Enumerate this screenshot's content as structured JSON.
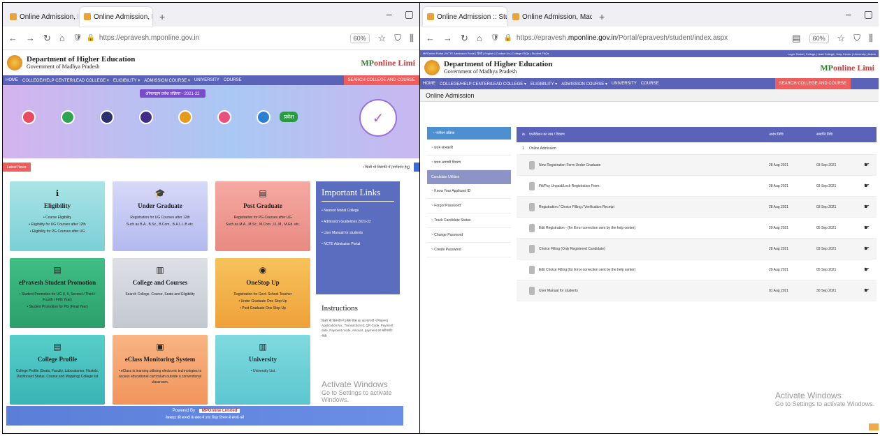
{
  "left": {
    "tabs": [
      {
        "title": "Online Admission, Madhya Pra",
        "active": false
      },
      {
        "title": "Online Admission, Madhya Pra",
        "active": true
      }
    ],
    "url": "https://epravesh.mponline.gov.in",
    "zoom": "60%",
    "site": {
      "dept": "Department of Higher Education",
      "gov": "Government of Madhya Pradesh",
      "brand_a": "MP",
      "brand_b": "online Limi",
      "menu": [
        "HOME",
        "COLLEGE/HELP CENTER/LEAD COLLEGE ▾",
        "ELIGIBILITY ▾",
        "ADMISSION COURSE ▾",
        "UNIVERSITY",
        "COURSE"
      ],
      "search": "SEARCH COLLEGE AND COURSE"
    },
    "hero": {
      "badge": "ऑनलाइन प्रवेश प्रक्रिया - 2021-22",
      "prav": "प्रवेश"
    },
    "ticker": {
      "label": "Latest News",
      "text": "• किसी भी विसंगति में (मार्गदर्शन हेतु)"
    },
    "cards": [
      {
        "title": "Eligibility",
        "desc1": "• Course Eligibility",
        "desc2": "• Eligibility for UG Courses after 12th",
        "desc3": "• Eligibility for PG Courses after UG"
      },
      {
        "title": "Under Graduate",
        "desc1": "Registration for UG Courses after 12th",
        "desc2": "Such as B.A., B.Sc., B.Com., B.A.L.L.B etc.",
        "desc3": ""
      },
      {
        "title": "Post Graduate",
        "desc1": "Registration for PG Courses after UG",
        "desc2": "Such as M.A., M.Sc., M.Com., LL.M., M.Ed. etc.",
        "desc3": ""
      },
      {
        "title": "ePravesh Student Promotion",
        "desc1": "• Student Promotion for UG (I, II, Second / Third / Fourth / Fifth Year)",
        "desc2": "• Student Promotion for PG (Final Year)",
        "desc3": ""
      },
      {
        "title": "College and Courses",
        "desc1": "Search College, Course, Seats and Eligibility",
        "desc2": "",
        "desc3": ""
      },
      {
        "title": "OneStop Up",
        "desc1": "Registration for Govt. School Teacher",
        "desc2": "• Under Graduate One Stop Up",
        "desc3": "• Post Graduate One Stop Up"
      },
      {
        "title": "College Profile",
        "desc1": "College Profile (Seats, Faculty, Laboratories, Hostels, Dashboard Status, Course and Mapping) College list",
        "desc2": "",
        "desc3": ""
      },
      {
        "title": "eClass Monitoring System",
        "desc1": "• eClass is learning utilising electronic technologies to access educational curriculum outside a conventional classroom.",
        "desc2": "",
        "desc3": ""
      },
      {
        "title": "University",
        "desc1": "• University List",
        "desc2": "",
        "desc3": ""
      }
    ],
    "links": {
      "title": "Important Links",
      "items": [
        "• Nearest Nodal College",
        "• Admission Guidelines 2021-22",
        "• User Manual for students",
        "• NCTE Admission Portal"
      ]
    },
    "instructions": {
      "title": "Instructions",
      "text": "किसी भी विसंगति में (जैसे फीस का कटना/पर्ची न निकलना) Application No., Transaction Id, QR Code, Payment date, Payment mode, Amount, payment का स्क्रीनशॉट भेजें।"
    },
    "activate": {
      "line1": "Activate Windows",
      "line2": "Go to Settings to activate Windows."
    },
    "footer": {
      "powered": "Powered By",
      "brand": "MPOnline Limited",
      "note": "वेबसाइट की सामग्री के संबंध में उच्च शिक्षा विभाग से संपर्क करें"
    }
  },
  "right": {
    "tabs": [
      {
        "title": "Online Admission :: Student",
        "active": true
      },
      {
        "title": "Online Admission, Madhya Pra",
        "active": false
      }
    ],
    "url_pre": "https://epravesh.",
    "url_main": "mponline.gov.in",
    "url_post": "/Portal/epravesh/student/index.aspx",
    "zoom": "60%",
    "breadcrumb": "MPOnline Portal | NCTE Admission Portal | हिन्दी | English | Contact Us | College FAQs | Student FAQs",
    "login": "Login: Nodal | College | Lead College | Help Center | University | Admin",
    "page_title": "Online Admission",
    "sidebar": {
      "header": "~ पंजीयन प्रक्रिया",
      "items1": [
        "~ प्रथम जानकारी",
        "~ प्रथम आगामी विवरण"
      ],
      "section": "Candidate Utilities",
      "items2": [
        "~ Know Your Applicant ID",
        "~ Forgot Password",
        "~ Track Candidate Status",
        "~ Change Password",
        "~ Create Password"
      ]
    },
    "table": {
      "headers": [
        "क्र.",
        "एप्लीकेशन का नाम / विवरण",
        "आरंभ तिथि",
        "समाप्ति तिथि"
      ],
      "group_no": "1",
      "group": "Online Admission",
      "rows": [
        {
          "name": "New Registration Form Under Graduate",
          "start": "28 Aug 2021",
          "end": "03 Sep 2021"
        },
        {
          "name": "FA/Pay Unpaid/Lock Registration Form",
          "start": "28 Aug 2021",
          "end": "03 Sep 2021"
        },
        {
          "name": "Registration / Choice Filling / Verification Receipt",
          "start": "28 Aug 2021",
          "end": "03 Sep 2021"
        },
        {
          "name": "Edit Registration - (for Error correction sent by the help center)",
          "start": "29 Aug 2021",
          "end": "05 Sep 2021"
        },
        {
          "name": "Choice Filling (Only Registered Candidate)",
          "start": "28 Aug 2021",
          "end": "03 Sep 2021"
        },
        {
          "name": "Edit Choice Filling (for Error correction sent by the help center)",
          "start": "29 Aug 2021",
          "end": "05 Sep 2021"
        },
        {
          "name": "User Manual for students",
          "start": "01 Aug 2021",
          "end": "30 Sep 2021"
        }
      ]
    },
    "activate": {
      "line1": "Activate Windows",
      "line2": "Go to Settings to activate Windows."
    }
  }
}
